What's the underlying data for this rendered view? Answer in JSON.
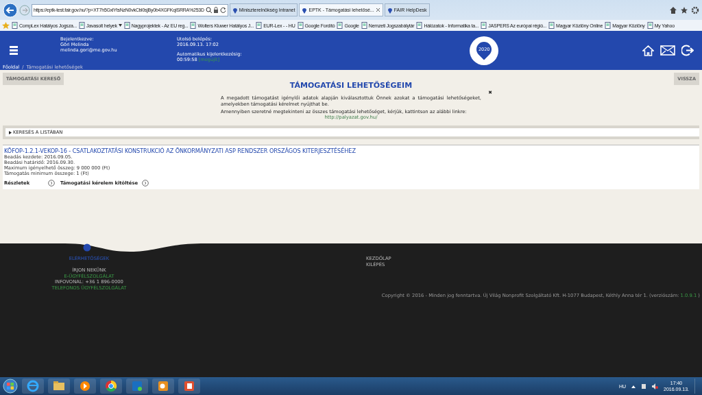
{
  "browser": {
    "url": "https://eptk-test.fair.gov.hu/?p=XT7h5GxlYtsNzN0vkCbl0sjBy0b4XGFKqISRRA%253D",
    "tabs": [
      {
        "title": "Miniszterelnökség Intranet",
        "selected": false
      },
      {
        "title": "EPTK - Támogatási lehetősé...",
        "selected": true
      },
      {
        "title": "FAIR HelpDesk",
        "selected": false
      }
    ],
    "favorites": [
      "CompLex Hatályos Jogsza...",
      "Javasolt helyek",
      "Nagyprojektek - Az EU reg...",
      "Wolters Kluwer Hatályos J...",
      "EUR-Lex - - HU",
      "Google Fordító",
      "Google",
      "Nemzeti Jogszabálytár",
      "Hálózatok - Informatika ta...",
      "JASPERS Az európai régió...",
      "Magyar Közlöny Online",
      "Magyar Közlöny",
      "My Yahoo"
    ]
  },
  "header": {
    "logged_in_label": "Bejelentkezve:",
    "user_name": "Göri Melinda",
    "user_email": "melinda.gori@me.gov.hu",
    "last_login_label": "Utolsó belépés:",
    "last_login": "2016.09.13. 17:02",
    "auto_logout_label": "Automatikus kijelentkezésig:",
    "countdown": "00:59:58",
    "extend_link": "[megújít]",
    "logo_text": "2020",
    "breadcrumb": [
      "Főoldal",
      "Támogatási lehetőségek"
    ],
    "breadcrumb_separator": "/"
  },
  "content": {
    "search_button": "TÁMOGATÁSI KERESŐ",
    "back_button": "VISSZA",
    "title": "TÁMOGATÁSI LEHETŐSÉGEIM",
    "close": "✖",
    "notice": [
      "A megadott támogatást igénylői adatok alapján kiválasztottuk Önnek azokat a támogatási lehetőségeket, amelyekben támogatási kérelmet nyújthat be.",
      "Amennyiben szeretné megtekinteni az összes támogatási lehetőséget, kérjük, kattintson az alábbi linkre:"
    ],
    "notice_link": "http://palyazat.gov.hu/",
    "search_toggle": "KERESÉS A LISTÁBAN",
    "calls": [
      {
        "title": "KÖFOP-1.2.1-VEKOP-16 - CSATLAKOZTATÁSI KONSTRUKCIÓ AZ ÖNKORMÁNYZATI ASP RENDSZER ORSZÁGOS KITERJESZTÉSÉHEZ",
        "details": [
          "Beadás kezdete: 2016.09.05.",
          "Beadási határidő: 2016.09.30.",
          "Maximum igényelhető összeg: 9 000 000 (Ft)",
          "Támogatás minimum összege: 1 (Ft)"
        ],
        "actions": [
          "Részletek",
          "Támogatási kérelem kitöltése"
        ]
      }
    ]
  },
  "footer": {
    "contact_heading": "ELÉRHETŐSÉGEK",
    "contact": [
      {
        "text": "ÍRJON NEKÜNK",
        "kind": "text"
      },
      {
        "text": "E-ÜGYFÉLSZOLGÁLAT",
        "kind": "link"
      },
      {
        "text": "INFOVONAL: +36 1 896-0000",
        "kind": "text"
      },
      {
        "text": "TELEFONOS ÜGYFÉLSZOLGÁLAT",
        "kind": "link"
      }
    ],
    "nav": [
      "KEZDŐLAP",
      "KILÉPÉS"
    ],
    "copyright": "Copyright © 2016 - Minden jog fenntartva. Új Világ Nonprofit Szolgáltató Kft. H-1077 Budapest, Kéthly Anna tér 1. (verziószám:",
    "version": "1.0.9.1",
    "copyright_end": ")"
  },
  "taskbar": {
    "language": "HU",
    "time": "17:40",
    "date": "2016.09.13."
  }
}
